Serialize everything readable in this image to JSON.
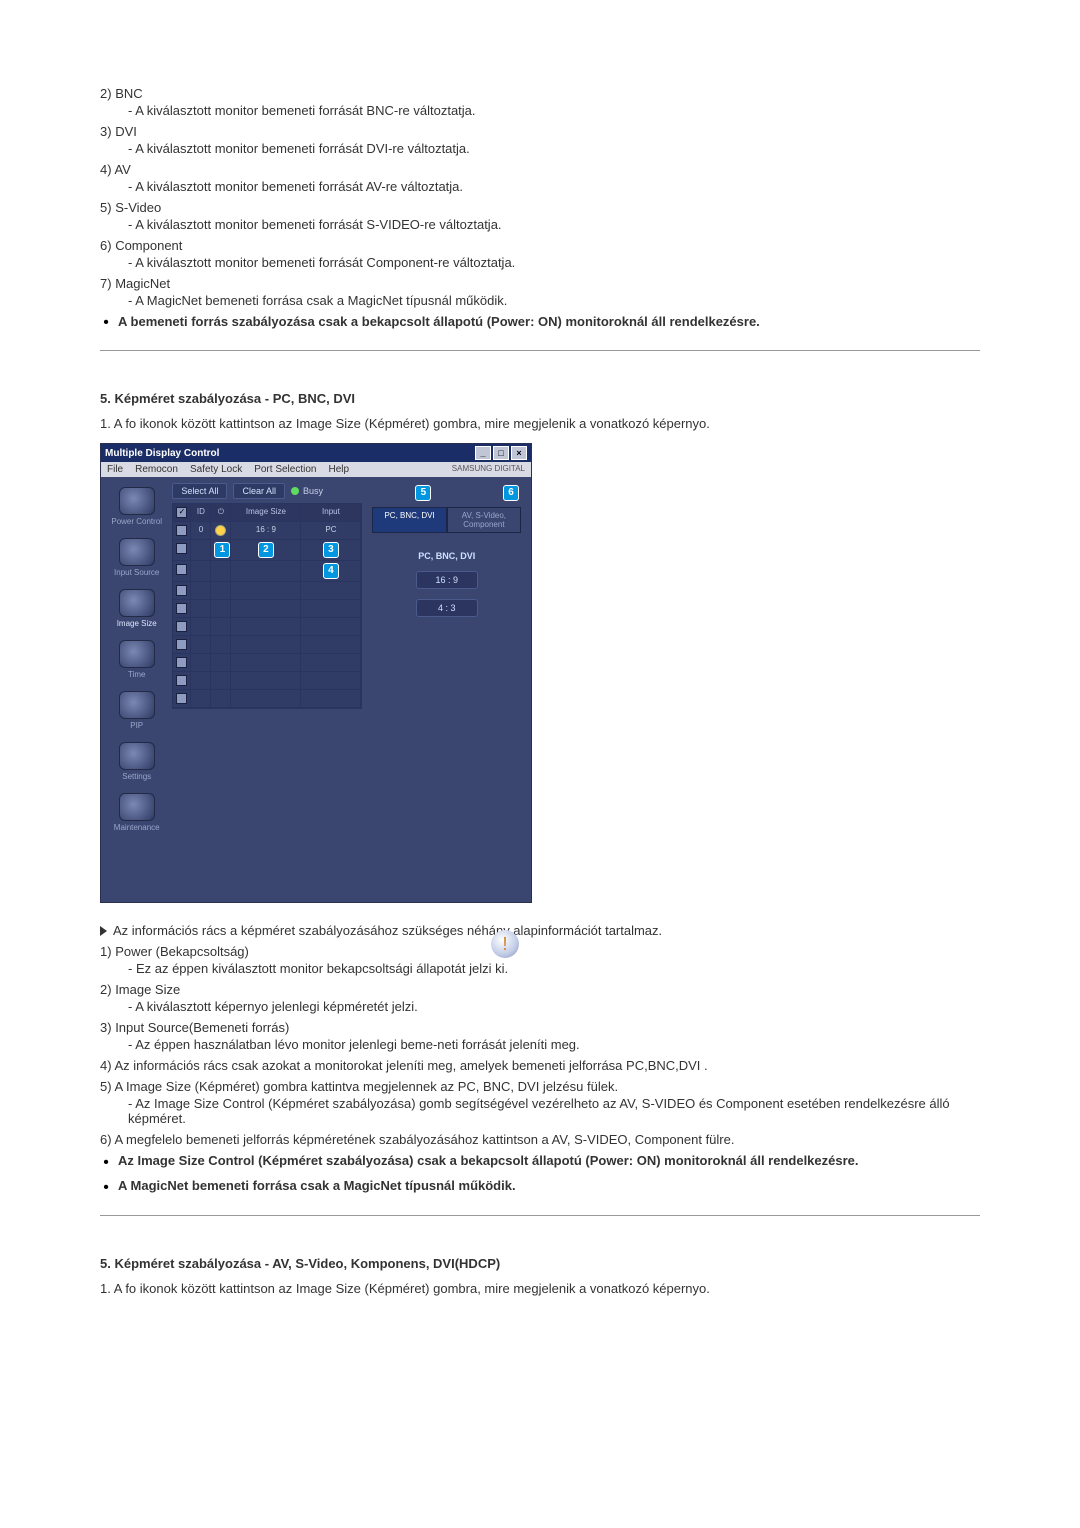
{
  "top_list": [
    {
      "num": "2)",
      "label": "BNC",
      "desc": "- A kiválasztott monitor bemeneti forrását BNC-re változtatja."
    },
    {
      "num": "3)",
      "label": "DVI",
      "desc": "- A kiválasztott monitor bemeneti forrását DVI-re változtatja."
    },
    {
      "num": "4)",
      "label": "AV",
      "desc": "- A kiválasztott monitor bemeneti forrását AV-re változtatja."
    },
    {
      "num": "5)",
      "label": "S-Video",
      "desc": "- A kiválasztott monitor bemeneti forrását S-VIDEO-re változtatja."
    },
    {
      "num": "6)",
      "label": "Component",
      "desc": "- A kiválasztott monitor bemeneti forrását Component-re változtatja."
    },
    {
      "num": "7)",
      "label": "MagicNet",
      "desc": "- A MagicNet bemeneti forrása csak a MagicNet típusnál működik."
    }
  ],
  "top_bullet": "A bemeneti forrás szabályozása csak a bekapcsolt állapotú (Power: ON) monitoroknál áll rendelkezésre.",
  "section5a": {
    "title": "5. Képméret szabályozása - PC, BNC, DVI",
    "intro_num": "1.",
    "intro": "A fo ikonok között kattintson az Image Size (Képméret) gombra, mire megjelenik a vonatkozó képernyo."
  },
  "app": {
    "title": "Multiple Display Control",
    "menu": [
      "File",
      "Remocon",
      "Safety Lock",
      "Port Selection",
      "Help"
    ],
    "brand": "SAMSUNG DIGITAL",
    "toolbar": {
      "select_all": "Select All",
      "clear_all": "Clear All",
      "busy": "Busy"
    },
    "sidebar": [
      "Power Control",
      "Input Source",
      "Image Size",
      "Time",
      "PIP",
      "Settings",
      "Maintenance"
    ],
    "grid_head": {
      "chk": "",
      "id": "ID",
      "pwr": "",
      "size": "Image Size",
      "input": "Input"
    },
    "grid_rows": [
      {
        "id": "0",
        "on": true,
        "size": "16 : 9",
        "input": "PC"
      }
    ],
    "callouts": {
      "c1": "1",
      "c2": "2",
      "c3": "3",
      "c4": "4",
      "c5": "5",
      "c6": "6"
    },
    "right": {
      "tab_active": "PC, BNC, DVI",
      "tab_inactive": "AV, S-Video, Component",
      "panel_title": "PC, BNC, DVI",
      "opt1": "16 : 9",
      "opt2": "4 : 3"
    }
  },
  "info_arrow": "Az információs rács a képméret szabályozásához szükséges néhány alapinformációt tartalmaz.",
  "mid_list": [
    {
      "num": "1)",
      "label": "Power (Bekapcsoltság)",
      "desc": "- Ez az éppen kiválasztott monitor bekapcsoltsági állapotát jelzi ki."
    },
    {
      "num": "2)",
      "label": "Image Size",
      "desc": "- A kiválasztott képernyo jelenlegi képméretét jelzi."
    },
    {
      "num": "3)",
      "label": "Input Source(Bemeneti forrás)",
      "desc": "- Az éppen használatban lévo monitor jelenlegi beme-neti forrását jeleníti meg."
    },
    {
      "num": "4)",
      "label": "Az információs rács csak azokat a monitorokat jeleníti meg, amelyek bemeneti jelforrása PC,BNC,DVI .",
      "desc": ""
    },
    {
      "num": "5)",
      "label": "A Image Size (Képméret) gombra kattintva megjelennek az PC, BNC, DVI jelzésu fülek.",
      "desc": "- Az Image Size Control (Képméret szabályozása) gomb segítségével vezérelheto az AV, S-VIDEO és Component esetében rendelkezésre álló képméret."
    },
    {
      "num": "6)",
      "label": "A megfelelo bemeneti jelforrás képméretének szabályozásához kattintson a AV, S-VIDEO, Component fülre.",
      "desc": ""
    }
  ],
  "mid_bullets": [
    "Az Image Size Control (Képméret szabályozása) csak a bekapcsolt állapotú (Power: ON) monitoroknál áll rendelkezésre.",
    "A MagicNet bemeneti forrása csak a MagicNet típusnál működik."
  ],
  "section5b": {
    "title": "5. Képméret szabályozása - AV, S-Video, Komponens, DVI(HDCP)",
    "intro_num": "1.",
    "intro": "A fo ikonok között kattintson az Image Size (Képméret) gombra, mire megjelenik a vonatkozó képernyo."
  }
}
